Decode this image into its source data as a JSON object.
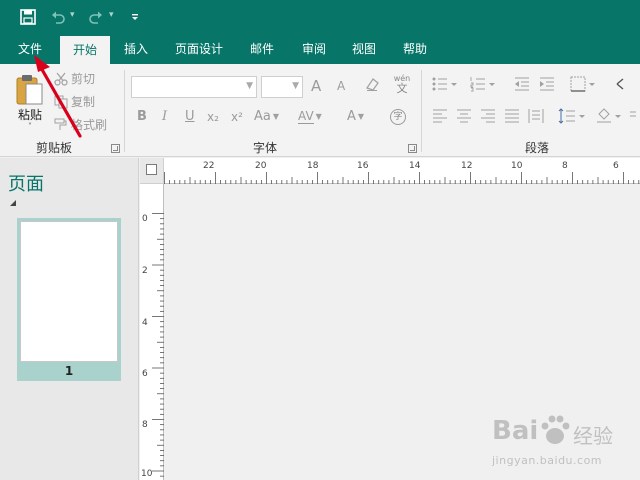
{
  "quick_access": {
    "save_icon": "floppy-disk-icon",
    "undo_icon": "undo-icon",
    "redo_icon": "redo-icon",
    "customize_icon": "customize-qat-icon"
  },
  "tabs": [
    {
      "label": "文件",
      "active": false
    },
    {
      "label": "开始",
      "active": true
    },
    {
      "label": "插入",
      "active": false
    },
    {
      "label": "页面设计",
      "active": false
    },
    {
      "label": "邮件",
      "active": false
    },
    {
      "label": "审阅",
      "active": false
    },
    {
      "label": "视图",
      "active": false
    },
    {
      "label": "帮助",
      "active": false
    }
  ],
  "clipboard": {
    "paste_label": "粘贴",
    "cut_label": "剪切",
    "copy_label": "复制",
    "format_painter_label": "格式刷",
    "group_label": "剪贴板"
  },
  "font": {
    "group_label": "字体",
    "bold": "B",
    "italic": "I",
    "underline": "U",
    "subscript": "x₂",
    "superscript": "x²",
    "char_spacing": "AV",
    "case_change": "Aa",
    "font_color": "A",
    "grow": "A",
    "shrink": "A",
    "phonetic_top": "wén",
    "phonetic_bottom": "文",
    "enclose_char": "字"
  },
  "paragraph": {
    "group_label": "段落"
  },
  "pages_pane": {
    "title": "页面",
    "page_number": "1"
  },
  "ruler": {
    "h_labels": [
      "22",
      "20",
      "18",
      "16",
      "14",
      "12",
      "10",
      "8",
      "6"
    ],
    "v_labels": [
      "0",
      "2",
      "4",
      "6",
      "8",
      "10"
    ]
  },
  "watermark": {
    "brand": "Bai",
    "brand2": "经验",
    "url": "jingyan.baidu.com"
  },
  "colors": {
    "accent": "#077568",
    "arrow": "#d9001b"
  }
}
